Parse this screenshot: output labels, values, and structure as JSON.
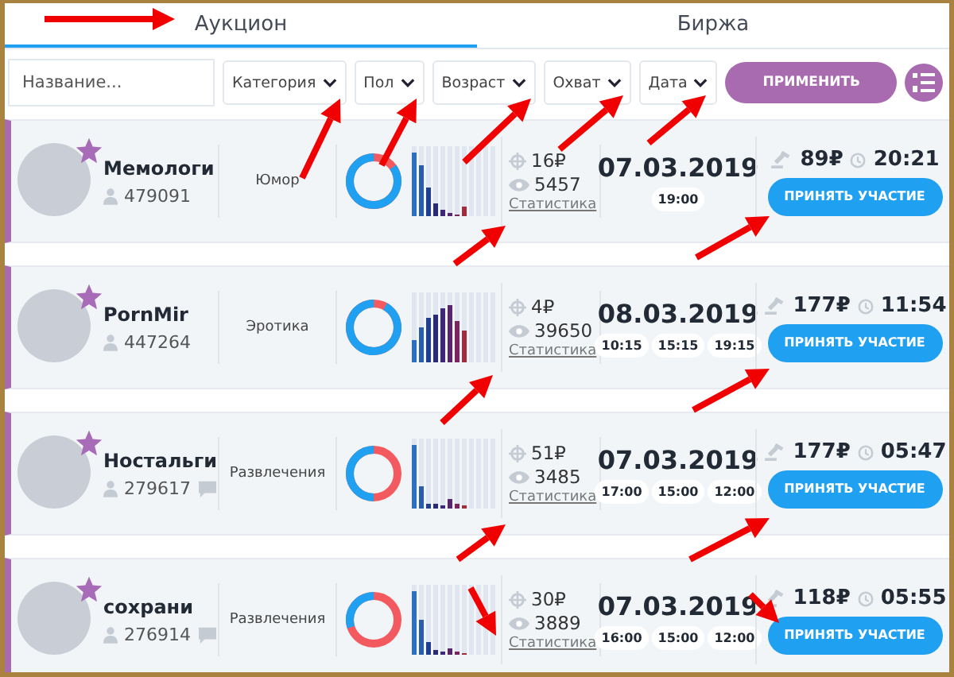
{
  "tabs": [
    {
      "label": "Аукцион",
      "selected": true
    },
    {
      "label": "Биржа",
      "selected": false
    }
  ],
  "filters": {
    "search": {
      "placeholder": "Название..."
    },
    "dropdowns": [
      "Категория",
      "Пол",
      "Возраст",
      "Охват",
      "Дата"
    ],
    "apply_button": "ПРИМЕНИТЬ"
  },
  "channels": [
    {
      "name": "Мемологи",
      "subscribers": "479091",
      "comments": false,
      "category": "Юмор",
      "gender": {
        "level": 0.85
      },
      "price": "16₽",
      "views": "5457",
      "stats_link": "Статистика",
      "date": "07.03.2019",
      "times": [
        "19:00"
      ],
      "bid": "89₽",
      "timer": "20:21",
      "button": "ПРИНЯТЬ УЧАСТИЕ"
    },
    {
      "name": "PornMir",
      "subscribers": "447264",
      "comments": false,
      "category": "Эротика",
      "gender": {
        "level": 0.92
      },
      "price": "4₽",
      "views": "39650",
      "stats_link": "Статистика",
      "date": "08.03.2019",
      "times": [
        "10:15",
        "15:15",
        "19:15"
      ],
      "bid": "177₽",
      "timer": "11:54",
      "button": "ПРИНЯТЬ УЧАСТИЕ"
    },
    {
      "name": "Ностальги",
      "subscribers": "279617",
      "comments": true,
      "category": "Развлечения",
      "gender": {
        "level": 0.5
      },
      "price": "51₽",
      "views": "3485",
      "stats_link": "Статистика",
      "date": "07.03.2019",
      "times": [
        "17:00",
        "15:00",
        "12:00"
      ],
      "bid": "177₽",
      "timer": "05:47",
      "button": "ПРИНЯТЬ УЧАСТИЕ"
    },
    {
      "name": "сохрани",
      "subscribers": "276914",
      "comments": true,
      "category": "Развлечения",
      "gender": {
        "level": 0.3
      },
      "price": "30₽",
      "views": "3889",
      "stats_link": "Статистика",
      "date": "07.03.2019",
      "times": [
        "16:00",
        "15:00",
        "12:00"
      ],
      "bid": "118₽",
      "timer": "05:55",
      "button": "ПРИНЯТЬ УЧАСТИЕ"
    }
  ]
}
